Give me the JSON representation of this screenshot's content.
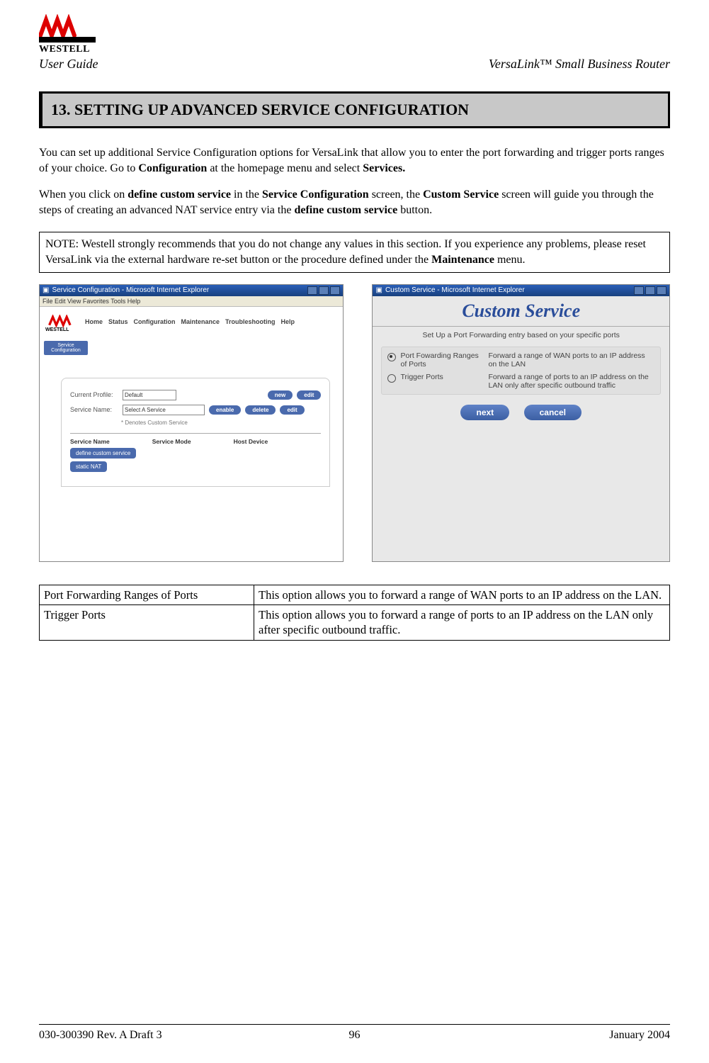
{
  "header": {
    "logo_text": "WESTELL",
    "user_guide": "User Guide",
    "product_name": "VersaLink™  Small Business Router"
  },
  "section_title": "13.  SETTING UP ADVANCED SERVICE CONFIGURATION",
  "para1_a": "You can set up additional Service Configuration options for VersaLink that allow you to enter the port forwarding and trigger ports ranges of your choice. Go to ",
  "para1_b1": "Configuration",
  "para1_c": " at the homepage menu and select ",
  "para1_b2": "Services.",
  "para2_a": "When you click on ",
  "para2_b1": "define custom service",
  "para2_c": " in the ",
  "para2_b2": "Service Configuration",
  "para2_d": " screen, the ",
  "para2_b3": "Custom Service",
  "para2_e": " screen will guide you through the steps of creating an advanced NAT service entry via the ",
  "para2_b4": "define custom service",
  "para2_f": " button.",
  "note_a": "NOTE: Westell strongly recommends that you do not change any values in this section. If you experience any problems, please reset VersaLink via the external hardware re-set button or the procedure defined under the ",
  "note_b": "Maintenance",
  "note_c": " menu.",
  "shot_a": {
    "ie_title": "Service Configuration - Microsoft Internet Explorer",
    "ie_menu": "File  Edit  View  Favorites  Tools  Help",
    "logo": "WESTELL",
    "nav_items": [
      "Home",
      "Status",
      "Configuration",
      "Maintenance",
      "Troubleshooting",
      "Help"
    ],
    "side_btn": "Service Configuration",
    "row1_label": "Current Profile:",
    "row1_value": "Default",
    "row2_label": "Service Name:",
    "row2_value": "Select A Service",
    "row2_sub": "*  Denotes Custom Service",
    "btns_top": [
      "new",
      "edit"
    ],
    "btns_mid": [
      "enable",
      "delete",
      "edit"
    ],
    "cols": [
      "Service Name",
      "Service Mode",
      "Host Device"
    ],
    "big_btn1": "define custom service",
    "big_btn2": "static NAT"
  },
  "shot_b": {
    "ie_title": "Custom Service - Microsoft Internet Explorer",
    "title": "Custom Service",
    "subtitle": "Set Up a Port Forwarding entry based on your specific ports",
    "opt1_label": "Port Fowarding Ranges of Ports",
    "opt1_desc": "Forward a range of WAN ports to an IP address on the LAN",
    "opt2_label": "Trigger Ports",
    "opt2_desc": "Forward a range of ports to an IP address on the LAN only after specific outbound traffic",
    "btn_next": "next",
    "btn_cancel": "cancel"
  },
  "table": {
    "rows": [
      {
        "label": "Port Forwarding Ranges of Ports",
        "desc": "This option allows you to forward a range of WAN ports to an IP address on the LAN."
      },
      {
        "label": "Trigger Ports",
        "desc": "This option allows you to forward a range of ports to an IP address on the LAN only after specific outbound traffic."
      }
    ]
  },
  "footer": {
    "left": "030-300390 Rev. A Draft 3",
    "center": "96",
    "right": "January 2004"
  }
}
